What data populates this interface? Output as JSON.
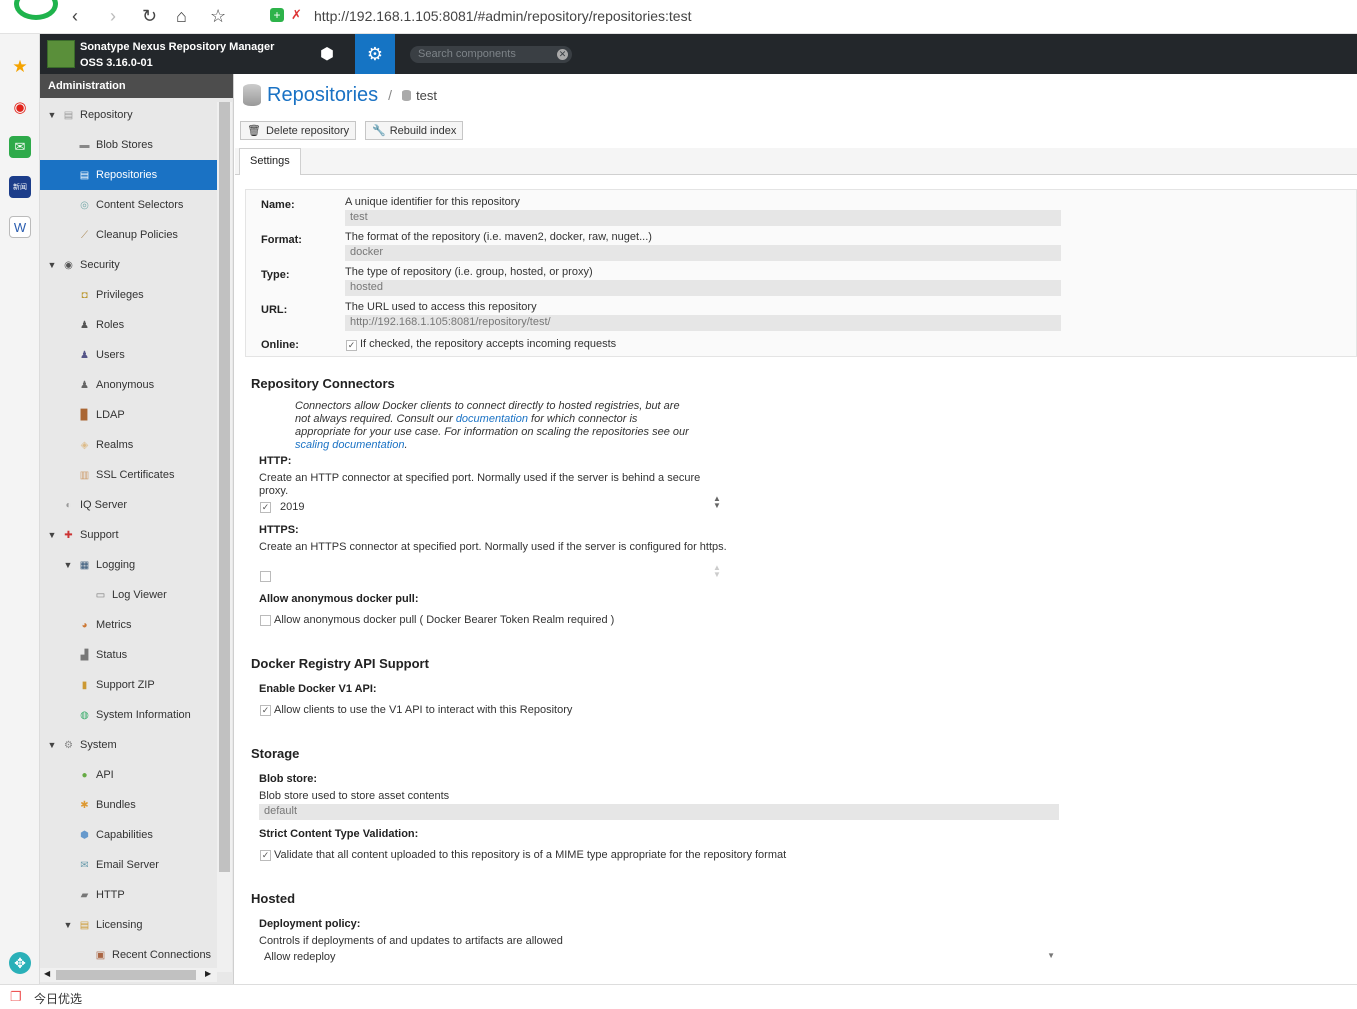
{
  "browser": {
    "url": "http://192.168.1.105:8081/#admin/repository/repositories:test",
    "bottom_label": "今日优选"
  },
  "header": {
    "brand_line1": "Sonatype Nexus Repository Manager",
    "brand_line2": "OSS 3.16.0-01",
    "search_placeholder": "Search components"
  },
  "sidebar": {
    "title": "Administration",
    "items": [
      {
        "label": "Repository",
        "icon": "database-icon"
      },
      {
        "label": "Blob Stores",
        "icon": "blob-store-icon"
      },
      {
        "label": "Repositories",
        "icon": "database-icon"
      },
      {
        "label": "Content Selectors",
        "icon": "selector-icon"
      },
      {
        "label": "Cleanup Policies",
        "icon": "broom-icon"
      },
      {
        "label": "Security",
        "icon": "eye-icon"
      },
      {
        "label": "Privileges",
        "icon": "badge-icon"
      },
      {
        "label": "Roles",
        "icon": "role-icon"
      },
      {
        "label": "Users",
        "icon": "users-icon"
      },
      {
        "label": "Anonymous",
        "icon": "anonymous-icon"
      },
      {
        "label": "LDAP",
        "icon": "book-icon"
      },
      {
        "label": "Realms",
        "icon": "shield-icon"
      },
      {
        "label": "SSL Certificates",
        "icon": "certificate-icon"
      },
      {
        "label": "IQ Server",
        "icon": "iq-server-icon"
      },
      {
        "label": "Support",
        "icon": "lifebuoy-icon"
      },
      {
        "label": "Logging",
        "icon": "log-icon"
      },
      {
        "label": "Log Viewer",
        "icon": "log-viewer-icon"
      },
      {
        "label": "Metrics",
        "icon": "pie-chart-icon"
      },
      {
        "label": "Status",
        "icon": "status-icon"
      },
      {
        "label": "Support ZIP",
        "icon": "zip-icon"
      },
      {
        "label": "System Information",
        "icon": "globe-icon"
      },
      {
        "label": "System",
        "icon": "gear-icon"
      },
      {
        "label": "API",
        "icon": "api-icon"
      },
      {
        "label": "Bundles",
        "icon": "puzzle-icon"
      },
      {
        "label": "Capabilities",
        "icon": "cube-icon"
      },
      {
        "label": "Email Server",
        "icon": "envelope-icon"
      },
      {
        "label": "HTTP",
        "icon": "truck-icon"
      },
      {
        "label": "Licensing",
        "icon": "license-icon"
      },
      {
        "label": "Recent Connections",
        "icon": "connections-icon"
      }
    ]
  },
  "main": {
    "breadcrumb_title": "Repositories",
    "breadcrumb_sep": "/",
    "breadcrumb_sub": "test",
    "delete_label": "Delete repository",
    "rebuild_label": "Rebuild index",
    "tab_settings": "Settings"
  },
  "form": {
    "name_label": "Name:",
    "name_help": "A unique identifier for this repository",
    "name_value": "test",
    "format_label": "Format:",
    "format_help": "The format of the repository (i.e. maven2, docker, raw, nuget...)",
    "format_value": "docker",
    "type_label": "Type:",
    "type_help": "The type of repository (i.e. group, hosted, or proxy)",
    "type_value": "hosted",
    "url_label": "URL:",
    "url_help": "The URL used to access this repository",
    "url_value": "http://192.168.1.105:8081/repository/test/",
    "online_label": "Online:",
    "online_help": "If checked, the repository accepts incoming requests",
    "connectors_title": "Repository Connectors",
    "connectors_intro_1": "Connectors allow Docker clients to connect directly to hosted registries, but are not always required. Consult our ",
    "connectors_link1": "documentation",
    "connectors_intro_2": " for which connector is appropriate for your use case. For information on scaling the repositories see our ",
    "connectors_link2": "scaling documentation",
    "connectors_intro_3": ".",
    "http_label": "HTTP:",
    "http_help": "Create an HTTP connector at specified port. Normally used if the server is behind a secure proxy.",
    "http_port": "2019",
    "https_label": "HTTPS:",
    "https_help": "Create an HTTPS connector at specified port. Normally used if the server is configured for https.",
    "anon_label": "Allow anonymous docker pull:",
    "anon_help": "Allow anonymous docker pull ( Docker Bearer Token Realm required )",
    "api_title": "Docker Registry API Support",
    "v1_label": "Enable Docker V1 API:",
    "v1_help": "Allow clients to use the V1 API to interact with this Repository",
    "storage_title": "Storage",
    "blob_label": "Blob store:",
    "blob_help": "Blob store used to store asset contents",
    "blob_value": "default",
    "strict_label": "Strict Content Type Validation:",
    "strict_help": "Validate that all content uploaded to this repository is of a MIME type appropriate for the repository format",
    "hosted_title": "Hosted",
    "deploy_label": "Deployment policy:",
    "deploy_help": "Controls if deployments of and updates to artifacts are allowed",
    "deploy_value": "Allow redeploy"
  }
}
